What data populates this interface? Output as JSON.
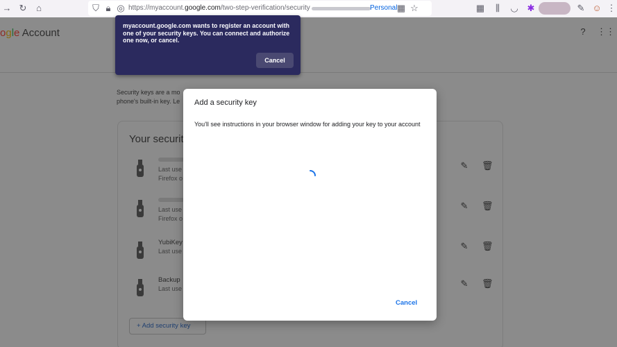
{
  "browser": {
    "url_prefix": "https://myaccount.",
    "url_domain": "google.com",
    "url_path": "/two-step-verification/security",
    "container_label": "Personal"
  },
  "header": {
    "logo_text": "Account"
  },
  "intro": {
    "line1": "Security keys are a mo",
    "line2": "phone's built-in key. Le"
  },
  "card": {
    "title": "Your securit",
    "keys": [
      {
        "name": "",
        "sub1": "Last use",
        "sub2": "Firefox o"
      },
      {
        "name": "",
        "sub1": "Last use",
        "sub2": "Firefox o"
      },
      {
        "name": "YubiKey",
        "sub1": "Last use",
        "sub2": ""
      },
      {
        "name": "Backup ",
        "sub1": "Last use",
        "sub2": ""
      }
    ],
    "add_button": "+ Add security key"
  },
  "permission_popup": {
    "message": "myaccount.google.com wants to register an account with one of your security keys. You can connect and authorize one now, or cancel.",
    "cancel_label": "Cancel"
  },
  "dialog": {
    "title": "Add a security key",
    "body": "You'll see instructions in your browser window for adding your key to your account",
    "cancel_label": "Cancel"
  },
  "colors": {
    "popup_bg": "#2b2a5e",
    "link_blue": "#1a73e8"
  }
}
